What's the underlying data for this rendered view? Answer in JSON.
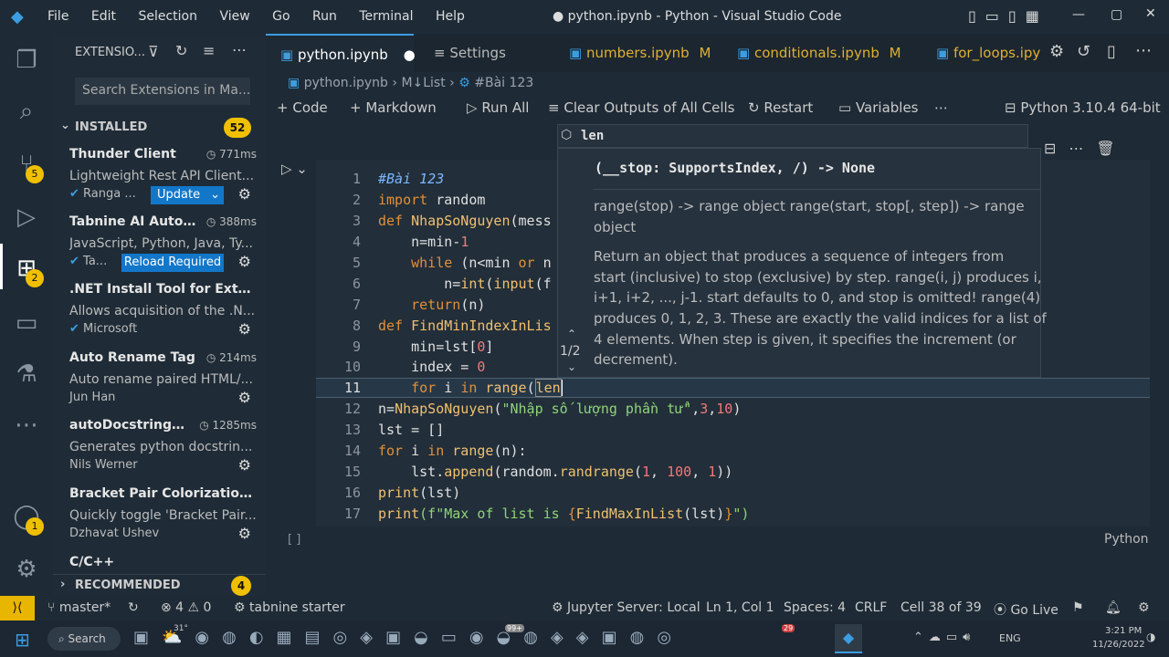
{
  "window": {
    "title": "● python.ipynb - Python - Visual Studio Code",
    "menu": [
      "File",
      "Edit",
      "Selection",
      "View",
      "Go",
      "Run",
      "Terminal",
      "Help"
    ]
  },
  "sidebar": {
    "header": "EXTENSIO...",
    "search_placeholder": "Search Extensions in Ma...",
    "installed_label": "INSTALLED",
    "installed_count": "52",
    "extensions": [
      {
        "name": "Thunder Client",
        "time": "771ms",
        "desc": "Lightweight Rest API Client...",
        "publisher": "Ranga ...",
        "action": "Update"
      },
      {
        "name": "Tabnine AI Autoc...",
        "time": "388ms",
        "desc": "JavaScript, Python, Java, Ty...",
        "publisher": "Ta...",
        "action": "Reload Required"
      },
      {
        "name": ".NET Install Tool for Exte...",
        "time": "",
        "desc": "Allows acquisition of the .N...",
        "publisher": "Microsoft",
        "action": ""
      },
      {
        "name": "Auto Rename Tag",
        "time": "214ms",
        "desc": "Auto rename paired HTML/...",
        "publisher": "Jun Han",
        "action": ""
      },
      {
        "name": "autoDocstring - ...",
        "time": "1285ms",
        "desc": "Generates python docstrin...",
        "publisher": "Nils Werner",
        "action": ""
      },
      {
        "name": "Bracket Pair Colorization ...",
        "time": "",
        "desc": "Quickly toggle 'Bracket Pair...",
        "publisher": "Dzhavat Ushev",
        "action": ""
      }
    ],
    "partial": "C/C++",
    "recommended_label": "RECOMMENDED",
    "recommended_count": "4"
  },
  "activity": {
    "source_badge": "5",
    "ext_badge": "2",
    "account_badge": "1"
  },
  "tabs": [
    {
      "label": "python.ipynb",
      "mark": "●"
    },
    {
      "label": "Settings",
      "mark": ""
    },
    {
      "label": "numbers.ipynb",
      "mark": "M"
    },
    {
      "label": "conditionals.ipynb",
      "mark": "M"
    },
    {
      "label": "for_loops.ipy",
      "mark": ""
    }
  ],
  "breadcrumb": {
    "file": "python.ipynb",
    "list": "M↓List",
    "section": "#Bài 123"
  },
  "toolbar": {
    "code": "Code",
    "markdown": "Markdown",
    "run_all": "Run All",
    "clear": "Clear Outputs of All Cells",
    "restart": "Restart",
    "variables": "Variables",
    "kernel": "Python 3.10.4 64-bit"
  },
  "suggest": {
    "item": "len"
  },
  "hover": {
    "signature": "(__stop: SupportsIndex, /) -> None",
    "line1": "range(stop) -> range object range(start, stop[, step]) -> range",
    "line2": "object",
    "body": [
      "Return an object that produces a sequence of integers from",
      "start (inclusive) to stop (exclusive) by step. range(i, j) produces i,",
      "i+1, i+2, ..., j-1. start defaults to 0, and stop is omitted! range(4)",
      "produces 0, 1, 2, 3. These are exactly the valid indices for a list of",
      "4 elements. When step is given, it specifies the increment (or",
      "decrement)."
    ],
    "pager": "1/2"
  },
  "code": {
    "line_numbers": [
      "1",
      "2",
      "3",
      "4",
      "5",
      "6",
      "7",
      "8",
      "9",
      "10",
      "11",
      "12",
      "13",
      "14",
      "15",
      "16",
      "17"
    ],
    "l1": "#Bài 123",
    "l2a": "import",
    "l2b": " random",
    "l3a": "def ",
    "l3b": "NhapSoNguyen",
    "l3c": "(mess",
    "l4a": "    n=min-",
    "l4b": "1",
    "l5a": "    while ",
    "l5b": "(n<min ",
    "l5c": "or",
    "l5d": " n",
    "l6a": "        n=",
    "l6b": "int",
    "l6c": "(",
    "l6d": "input",
    "l6e": "(f",
    "l7a": "    return",
    "l7b": "(n)",
    "l8a": "def ",
    "l8b": "FindMinIndexInLis",
    "l9a": "    min=lst[",
    "l9b": "0",
    "l9c": "]",
    "l10a": "    index = ",
    "l10b": "0",
    "l11a": "    for ",
    "l11b": "i ",
    "l11c": "in ",
    "l11d": "range",
    "l11e": "(",
    "l11f": "len",
    "l12a": "n=",
    "l12b": "NhapSoNguyen",
    "l12c": "(",
    "l12d": "\"Nhập số lượng phần tử\"",
    "l12e": ",",
    "l12f": "3",
    "l12g": ",",
    "l12h": "10",
    "l12i": ")",
    "l13": "lst = []",
    "l14a": "for ",
    "l14b": "i ",
    "l14c": "in ",
    "l14d": "range",
    "l14e": "(n):",
    "l15a": "    lst.",
    "l15b": "append",
    "l15c": "(random.",
    "l15d": "randrange",
    "l15e": "(",
    "l15f": "1",
    "l15g": ", ",
    "l15h": "100",
    "l15i": ", ",
    "l15j": "1",
    "l15k": "))",
    "l16a": "print",
    "l16b": "(lst)",
    "l17a": "print",
    "l17b": "(f\"Max of list is ",
    "l17c": "{",
    "l17d": "FindMaxInList",
    "l17e": "(lst)",
    "l17f": "}",
    "l17g": "\")",
    "lang": "Python",
    "exec": "[ ]"
  },
  "status": {
    "branch": "master*",
    "problems": "⊗ 4  ⚠ 0",
    "tabnine": "tabnine starter",
    "jupyter": "Jupyter Server: Local",
    "pos": "Ln 1, Col 1",
    "spaces": "Spaces: 4",
    "eol": "CRLF",
    "cell": "Cell 38 of 39",
    "golive": "Go Live"
  },
  "taskbar": {
    "search": "Search",
    "temp": "31°",
    "time": "3:21 PM",
    "date": "11/26/2022",
    "lang": "ENG",
    "badge1": "99+",
    "badge2": "29"
  }
}
